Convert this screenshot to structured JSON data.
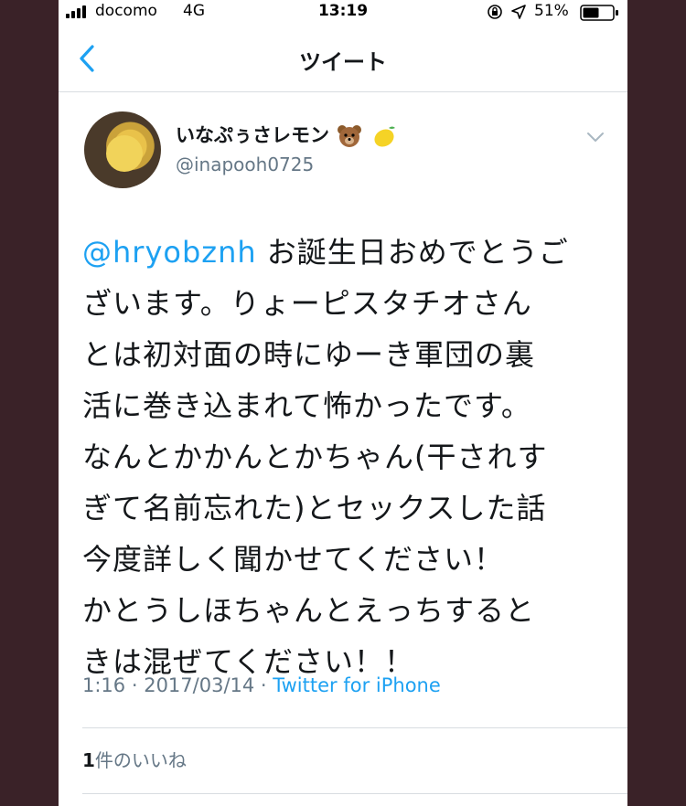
{
  "status_bar": {
    "carrier": "docomo",
    "network": "4G",
    "time": "13:19",
    "battery": "51%"
  },
  "nav": {
    "title": "ツイート"
  },
  "tweet": {
    "display_name": "いなぷぅさレモン",
    "name_emojis": [
      "bear-face-emoji",
      "lemon-emoji"
    ],
    "handle": "@inapooh0725",
    "mention": "@hryobznh",
    "lines": [
      " お誕生日おめでとうご",
      "ざいます。りょーピスタチオさん",
      "とは初対面の時にゆーき軍団の裏",
      "活に巻き込まれて怖かったです。",
      "なんとかかんとかちゃん(干されす",
      "ぎて名前忘れた)とセックスした話",
      "今度詳しく聞かせてください！",
      "かとうしほちゃんとえっちすると",
      "きは混ぜてください！！"
    ],
    "time": "1:16",
    "date": "2017/03/14",
    "separator": " · ",
    "source": "Twitter for iPhone",
    "likes_count": "1",
    "likes_label": "件のいいね"
  },
  "colors": {
    "accent": "#1da1f2",
    "text": "#14171a",
    "secondary": "#657786",
    "background_outside": "#3a2228"
  }
}
